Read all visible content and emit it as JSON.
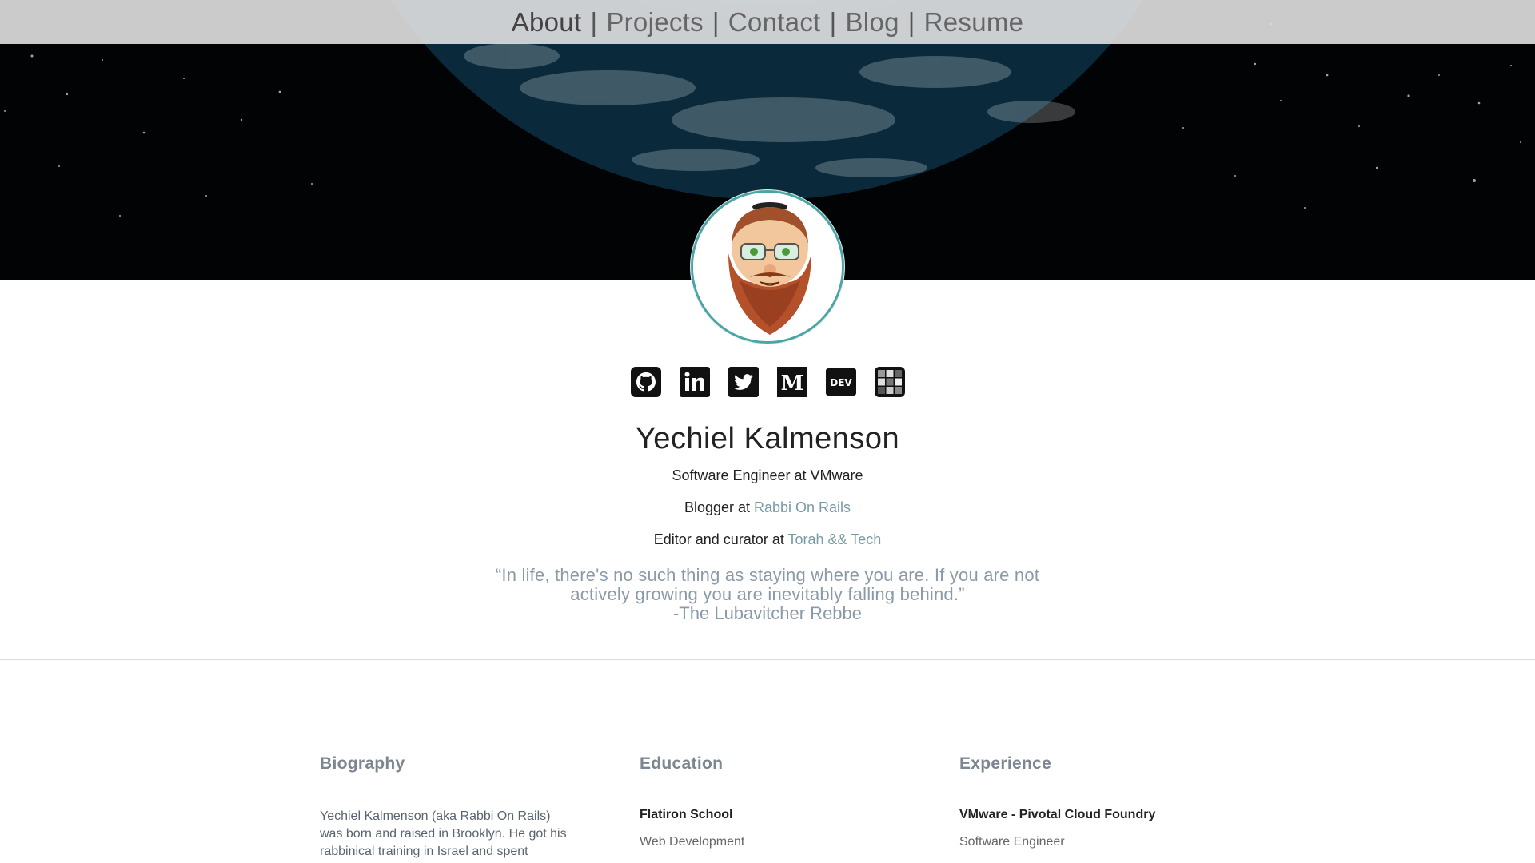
{
  "nav": {
    "items": [
      {
        "label": "About"
      },
      {
        "label": "Projects"
      },
      {
        "label": "Contact"
      },
      {
        "label": "Blog"
      },
      {
        "label": "Resume"
      }
    ],
    "separator": "|"
  },
  "social": {
    "items": [
      {
        "name": "github-icon"
      },
      {
        "name": "linkedin-icon"
      },
      {
        "name": "twitter-icon"
      },
      {
        "name": "medium-icon"
      },
      {
        "name": "dev-icon",
        "text": "DEV"
      },
      {
        "name": "grid-logo-icon"
      }
    ]
  },
  "profile": {
    "name": "Yechiel Kalmenson",
    "role": "Software Engineer at VMware",
    "blogger_prefix": "Blogger at ",
    "blogger_link": "Rabbi On Rails",
    "editor_prefix": "Editor and curator at ",
    "editor_link": "Torah && Tech",
    "quote": "“In life, there's no such thing as staying where you are. If you are not actively growing you are inevitably falling behind.”",
    "quote_author": "-The Lubavitcher Rebbe"
  },
  "sections": {
    "biography": {
      "title": "Biography",
      "text": "Yechiel Kalmenson (aka Rabbi On Rails) was born and raised in Brooklyn. He got his rabbinical training in Israel and spent"
    },
    "education": {
      "title": "Education",
      "school": "Flatiron School",
      "program": "Web Development"
    },
    "experience": {
      "title": "Experience",
      "company": "VMware - Pivotal Cloud Foundry",
      "position": "Software Engineer"
    }
  },
  "colors": {
    "accent": "#7a9aa8",
    "avatar_border": "#4aa6a6",
    "hero_bg": "#000000"
  }
}
